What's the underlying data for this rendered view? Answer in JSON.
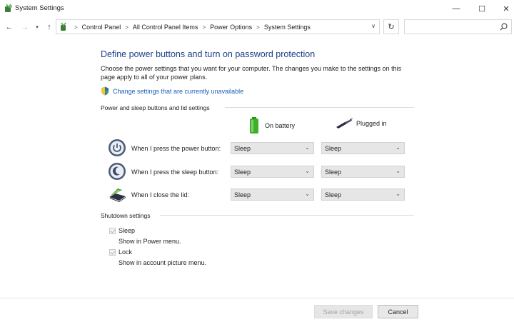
{
  "window": {
    "title": "System Settings",
    "minimize": "—",
    "maximize": "☐",
    "close": "✕"
  },
  "nav": {
    "back": "←",
    "forward": "→",
    "recent": "▾",
    "up": "↑",
    "breadcrumbs": [
      "Control Panel",
      "All Control Panel Items",
      "Power Options",
      "System Settings"
    ],
    "separator": ">",
    "dropdown": "∨",
    "refresh": "↻",
    "search_placeholder": ""
  },
  "page": {
    "heading": "Define power buttons and turn on password protection",
    "description": "Choose the power settings that you want for your computer. The changes you make to the settings on this page apply to all of your power plans.",
    "uac_link": "Change settings that are currently unavailable"
  },
  "power_section": {
    "header": "Power and sleep buttons and lid settings",
    "columns": {
      "battery": "On battery",
      "plugged": "Plugged in"
    },
    "rows": [
      {
        "label": "When I press the power button:",
        "battery": "Sleep",
        "plugged": "Sleep",
        "icon": "power-button-icon"
      },
      {
        "label": "When I press the sleep button:",
        "battery": "Sleep",
        "plugged": "Sleep",
        "icon": "sleep-button-icon"
      },
      {
        "label": "When I close the lid:",
        "battery": "Sleep",
        "plugged": "Sleep",
        "icon": "laptop-lid-icon"
      }
    ]
  },
  "shutdown_section": {
    "header": "Shutdown settings",
    "items": [
      {
        "label": "Sleep",
        "sub": "Show in Power menu.",
        "checked": true
      },
      {
        "label": "Lock",
        "sub": "Show in account picture menu.",
        "checked": true
      }
    ]
  },
  "footer": {
    "save": "Save changes",
    "cancel": "Cancel"
  },
  "colors": {
    "heading": "#1d3f8c",
    "link": "#1a5fb4",
    "battery_green": "#3fae2a"
  }
}
